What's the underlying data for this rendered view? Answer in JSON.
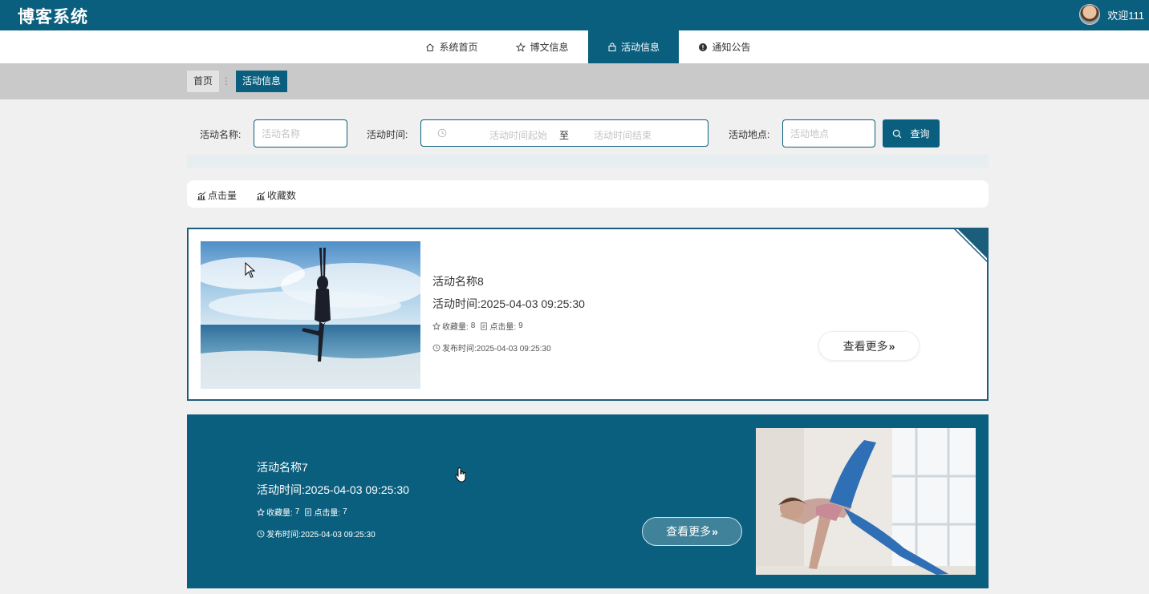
{
  "header": {
    "logo": "博客系统",
    "welcome": "欢迎111"
  },
  "nav": {
    "items": [
      {
        "label": "系统首页",
        "icon": "home-icon"
      },
      {
        "label": "博文信息",
        "icon": "star-icon"
      },
      {
        "label": "活动信息",
        "icon": "bag-icon"
      },
      {
        "label": "通知公告",
        "icon": "alert-icon"
      }
    ],
    "active_index": 2
  },
  "breadcrumb": {
    "home": "首页",
    "separator": "⋮",
    "current": "活动信息"
  },
  "search": {
    "name_label": "活动名称:",
    "name_placeholder": "活动名称",
    "time_label": "活动时间:",
    "time_start_placeholder": "活动时间起始",
    "time_separator": "至",
    "time_end_placeholder": "活动时间结束",
    "place_label": "活动地点:",
    "place_placeholder": "活动地点",
    "button": "查询"
  },
  "sort": {
    "clicks": "点击量",
    "favorites": "收藏数"
  },
  "cards": [
    {
      "title": "活动名称8",
      "time": "活动时间:2025-04-03 09:25:30",
      "fav_label": "收藏量:",
      "fav": "8",
      "click_label": "点击量:",
      "clicks": "9",
      "publish": "发布时间:2025-04-03 09:25:30",
      "more": "查看更多"
    },
    {
      "title": "活动名称7",
      "time": "活动时间:2025-04-03 09:25:30",
      "fav_label": "收藏量:",
      "fav": "7",
      "click_label": "点击量:",
      "clicks": "7",
      "publish": "发布时间:2025-04-03 09:25:30",
      "more": "查看更多"
    }
  ],
  "colors": {
    "primary": "#0b5f7e",
    "crumb_bg": "#c9c9c9",
    "page_bg": "#f0f0f0"
  }
}
